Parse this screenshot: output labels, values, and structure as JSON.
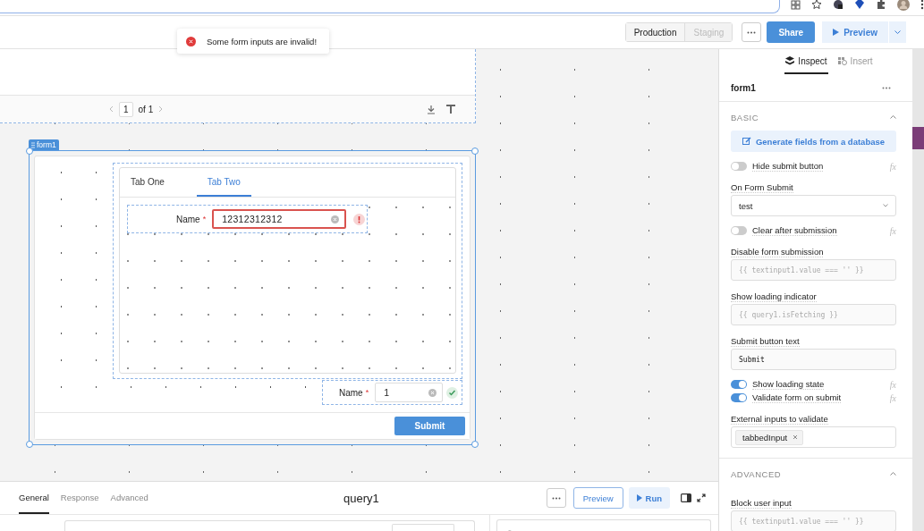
{
  "header": {
    "environments": [
      {
        "label": "Production",
        "selected": true
      },
      {
        "label": "Staging",
        "selected": false
      }
    ],
    "share": "Share",
    "preview": "Preview"
  },
  "toast": {
    "message": "Some form inputs are invalid!"
  },
  "table": {
    "page": "1",
    "page_total": "of 1"
  },
  "form": {
    "tag": "form1",
    "tabs": [
      {
        "label": "Tab One",
        "selected": false
      },
      {
        "label": "Tab Two",
        "selected": true
      }
    ],
    "fields": [
      {
        "label": "Name",
        "required_mark": "*",
        "value": "12312312312",
        "valid": false
      },
      {
        "label": "Name",
        "required_mark": "*",
        "value": "1",
        "valid": true
      }
    ],
    "submit": "Submit"
  },
  "inspector": {
    "tabs": [
      {
        "label": "Inspect",
        "selected": true
      },
      {
        "label": "Insert",
        "selected": false
      }
    ],
    "component": "form1",
    "sections": [
      {
        "title": "BASIC",
        "expanded": true,
        "items": [
          {
            "kind": "action",
            "label": "Generate fields from a database"
          },
          {
            "kind": "toggle",
            "label": "Hide submit button",
            "on": false,
            "formula": "fx"
          },
          {
            "kind": "select",
            "label": "On Form Submit",
            "value": "test"
          },
          {
            "kind": "toggle",
            "label": "Clear after submission",
            "on": false,
            "formula": "fx"
          },
          {
            "kind": "code",
            "label": "Disable form submission",
            "placeholder": "{{ textinput1.value === '' }}"
          },
          {
            "kind": "code",
            "label": "Show loading indicator",
            "placeholder": "{{ query1.isFetching }}"
          },
          {
            "kind": "text",
            "label": "Submit button text",
            "value": "Submit"
          },
          {
            "kind": "toggle",
            "label": "Show loading state",
            "on": true,
            "formula": "fx"
          },
          {
            "kind": "toggle",
            "label": "Validate form on submit",
            "on": true,
            "formula": "fx"
          },
          {
            "kind": "tags",
            "label": "External inputs to validate",
            "tags": [
              "tabbedInput"
            ]
          }
        ]
      },
      {
        "title": "ADVANCED",
        "expanded": true,
        "items": [
          {
            "kind": "code",
            "label": "Block user input",
            "placeholder": "{{ textinput1.value === '' }}"
          }
        ]
      }
    ]
  },
  "query": {
    "tabs": [
      {
        "label": "General",
        "selected": true
      },
      {
        "label": "Response",
        "selected": false
      },
      {
        "label": "Advanced",
        "selected": false
      }
    ],
    "title": "query1",
    "preview": "Preview",
    "run": "Run"
  }
}
